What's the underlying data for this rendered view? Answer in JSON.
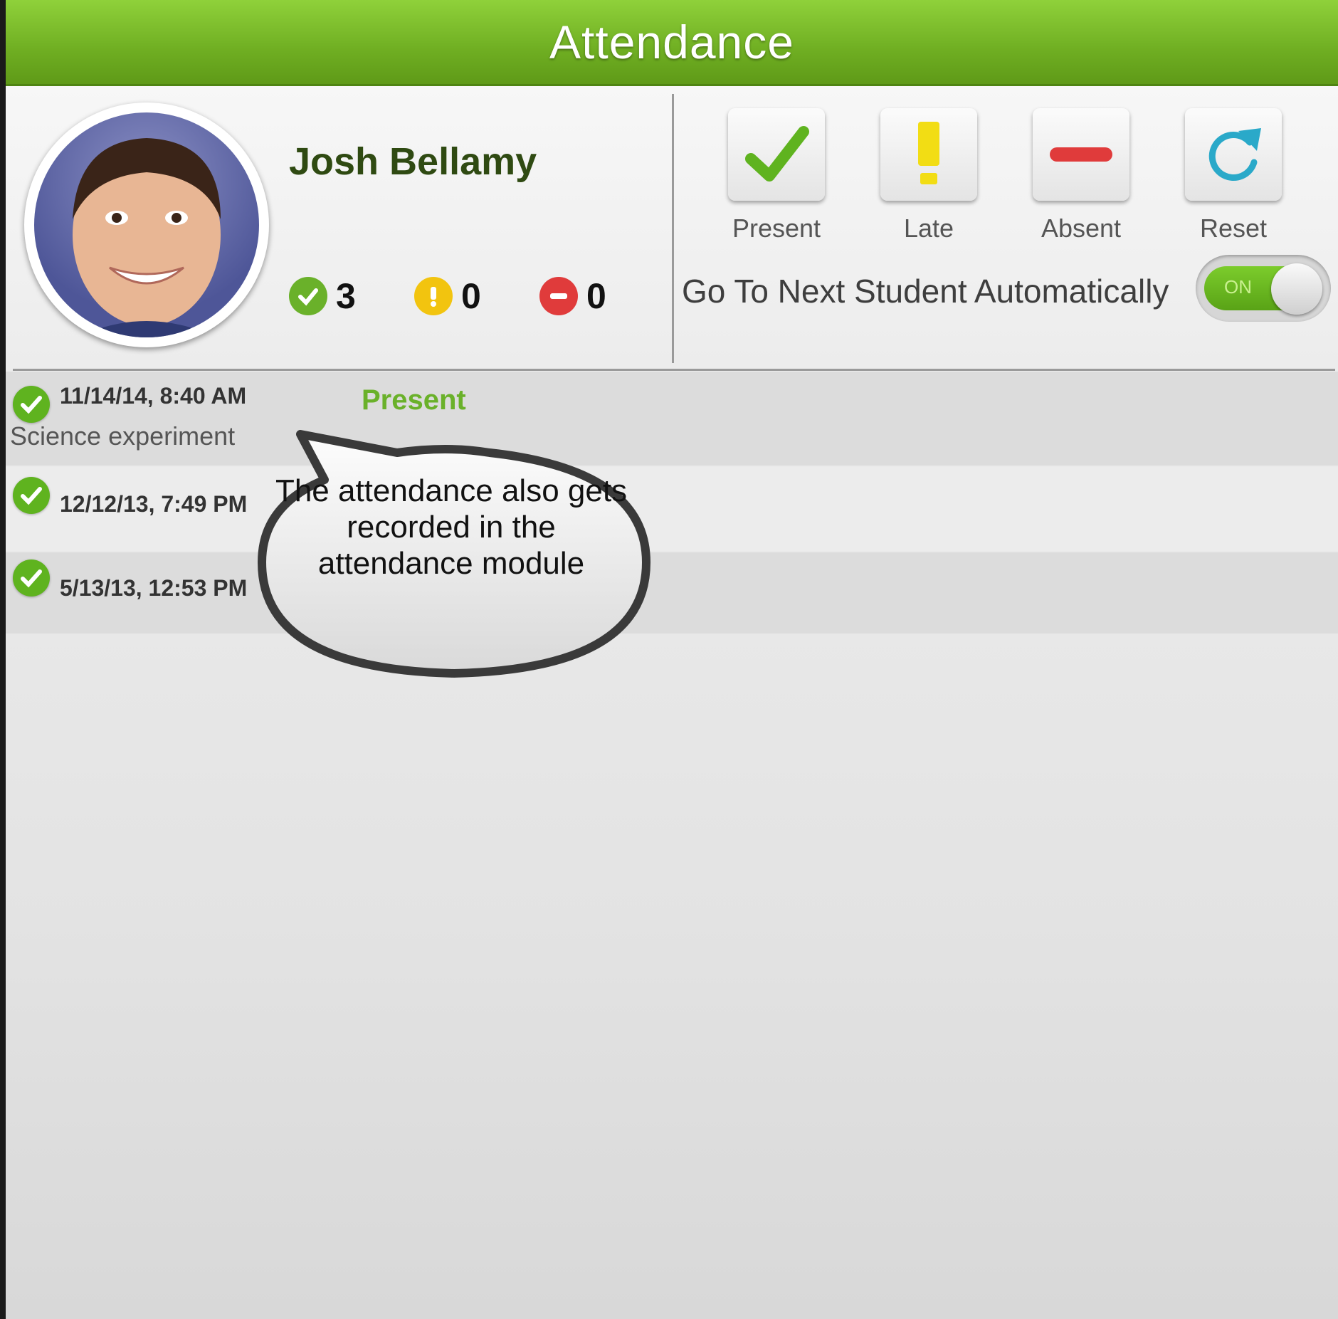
{
  "app": {
    "title": "Attendance"
  },
  "student": {
    "name": "Josh Bellamy",
    "stats": [
      {
        "icon": "present-check-icon",
        "count": "3",
        "color": "#6ab12a"
      },
      {
        "icon": "late-exclamation-icon",
        "count": "0",
        "color": "#f2c40f"
      },
      {
        "icon": "absent-minus-icon",
        "count": "0",
        "color": "#e03b3b"
      }
    ]
  },
  "actions": {
    "present": "Present",
    "late": "Late",
    "absent": "Absent",
    "reset": "Reset"
  },
  "auto_next": {
    "label": "Go To Next Student Automatically",
    "toggle": "ON",
    "enabled": true
  },
  "records": [
    {
      "datetime": "11/14/14, 8:40 AM",
      "note": "Science experiment",
      "status": "Present"
    },
    {
      "datetime": "12/12/13, 7:49 PM"
    },
    {
      "datetime": "5/13/13, 12:53 PM"
    }
  ],
  "callout": {
    "text": "The attendance also gets recorded in the attendance module"
  },
  "colors": {
    "accent": "#6fae22",
    "present": "#5fb31f",
    "late": "#f2c40f",
    "absent": "#e03b3b",
    "reset": "#2aa9c9"
  }
}
